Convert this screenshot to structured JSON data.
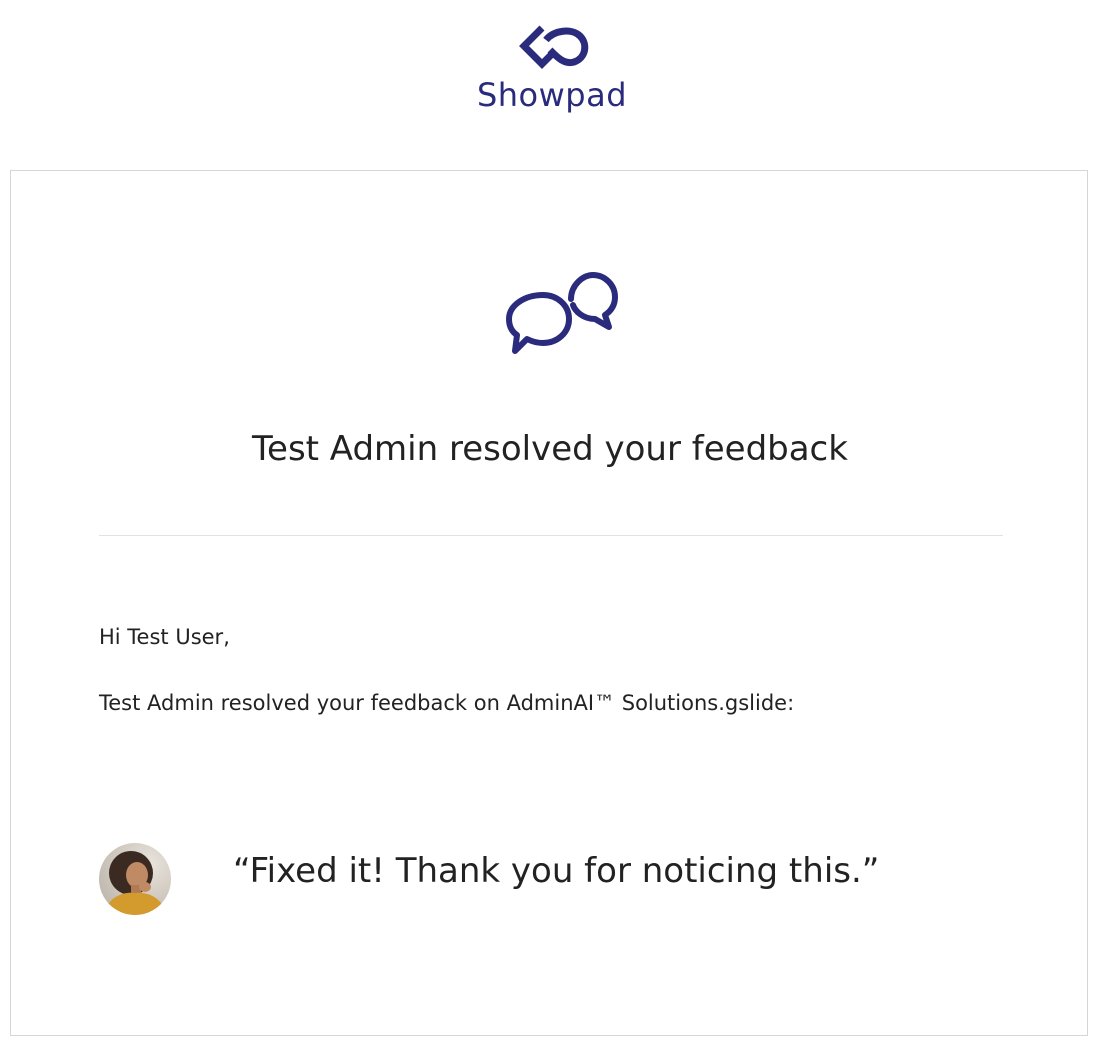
{
  "brand": {
    "name": "Showpad",
    "color": "#2a2b7c",
    "logo_icon": "showpad-infinity-icon"
  },
  "email": {
    "icon": "speech-bubbles-icon",
    "headline": "Test Admin resolved your feedback",
    "greeting": "Hi Test User,",
    "message": "Test Admin resolved your feedback on AdminAI™ Solutions.gslide:",
    "avatar": "user-avatar",
    "quote": "“Fixed it! Thank you for noticing this.”"
  },
  "colors": {
    "accent": "#2a2b7c",
    "text": "#222222",
    "border": "#d6d6d6"
  }
}
